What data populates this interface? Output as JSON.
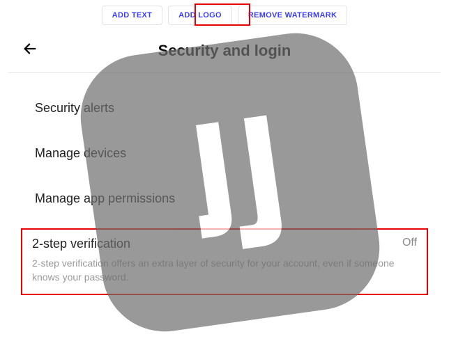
{
  "toolbar": {
    "add_text": "ADD TEXT",
    "add_logo": "ADD LOGO",
    "remove_watermark": "REMOVE WATERMARK"
  },
  "header": {
    "title": "Security and login"
  },
  "settings": {
    "alerts": "Security alerts",
    "devices": "Manage devices",
    "permissions": "Manage app permissions"
  },
  "two_step": {
    "title": "2-step verification",
    "status": "Off",
    "description": "2-step verification offers an extra layer of security for your account, even if someone knows your password."
  }
}
